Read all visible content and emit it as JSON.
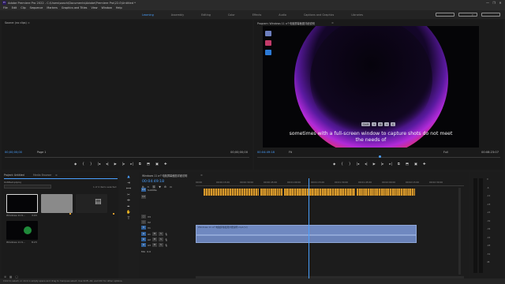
{
  "window": {
    "title": "Adobe Premiere Pro 2022 - C:\\Users\\saach\\Documents\\Adobe\\Premiere Pro\\22.0\\Untitled *",
    "app_badge": "Pr",
    "controls": [
      "—",
      "❐",
      "✕"
    ]
  },
  "menu": [
    "File",
    "Edit",
    "Clip",
    "Sequence",
    "Markers",
    "Graphics and Titles",
    "View",
    "Window",
    "Help"
  ],
  "workspaces": {
    "items": [
      "Learning",
      "Assembly",
      "Editing",
      "Color",
      "Effects",
      "Audio",
      "Captions and Graphics",
      "Libraries"
    ],
    "active": "Learning",
    "overflow": "»"
  },
  "source_monitor": {
    "tab": "Source: (no clips)",
    "menu": "≡",
    "timecode_left": "00;00;00;00",
    "page_label": "Page 1",
    "timecode_right": "00;00;00;00",
    "transport": [
      "◆",
      "{",
      "}",
      "|◂",
      "◂|",
      "▶",
      "|▸",
      "▸|",
      "⧉",
      "⬒",
      "▣",
      "✚"
    ]
  },
  "program_monitor": {
    "tab": "Program: Windows 11 a个电脑屏幕截图详细说明",
    "menu": "≡",
    "timecode_left": "00:04:49:18",
    "fit": "Fit",
    "quality": "Full",
    "timecode_right": "00:08:23:07",
    "subtitle_line1": "sometimes with a full-screen window to capture shots do not meet",
    "subtitle_line2": "the needs of",
    "shortcut_keys": [
      "Shift",
      "+",
      "⊞",
      "+",
      "S"
    ],
    "transport": [
      "◆",
      "{",
      "}",
      "|◂",
      "◂|",
      "▶",
      "|▸",
      "▸|",
      "⧉",
      "⬒",
      "▣",
      "✚"
    ]
  },
  "project_panel": {
    "tabs": [
      "Project: Untitled",
      "Media Browser",
      "≡"
    ],
    "filename": "Untitled.prproj",
    "item_count": "1 of 4 items selected",
    "items": [
      {
        "label": "Windows 11 K...",
        "duration": "3:03"
      },
      {
        "label": "",
        "duration": ""
      },
      {
        "label": "",
        "duration": ""
      },
      {
        "label": "Windows 11 K...",
        "duration": "8:23"
      }
    ]
  },
  "timeline": {
    "tab": "Windows 11 a个电脑屏幕截图详细说明",
    "menu": "≡",
    "timecode": "00:04:49:18",
    "ruler": [
      "00:00",
      "00:00:15:00",
      "00:00:30:00",
      "00:00:45:00",
      "00:01:00:00",
      "00:01:15:00",
      "00:01:30:00",
      "00:01:45:00",
      "00:02:00:00",
      "00:02:15:00",
      "00:02:30:00"
    ],
    "caption_track": "Subtitle",
    "video_tracks": [
      "V3",
      "V2",
      "V1"
    ],
    "audio_tracks": [
      "A1",
      "A2",
      "A3"
    ],
    "mix": "Mix",
    "mix_value": "0.0",
    "audio_clip_label": "Windows 11 a个电脑屏幕截图详细说明.mp4 [V]"
  },
  "meters": [
    "0",
    "-6",
    "-12",
    "-18",
    "-24",
    "-30",
    "-36",
    "-42",
    "-48",
    "-54",
    "dB"
  ],
  "status": "Click to select, or click in empty space and drag to marquee select. Use Shift, Alt, and Ctrl for other options.",
  "colors": {
    "accent": "#4aa0ff",
    "caption_segments": "#d89a2c",
    "audio_clip": "#6f88c0"
  }
}
